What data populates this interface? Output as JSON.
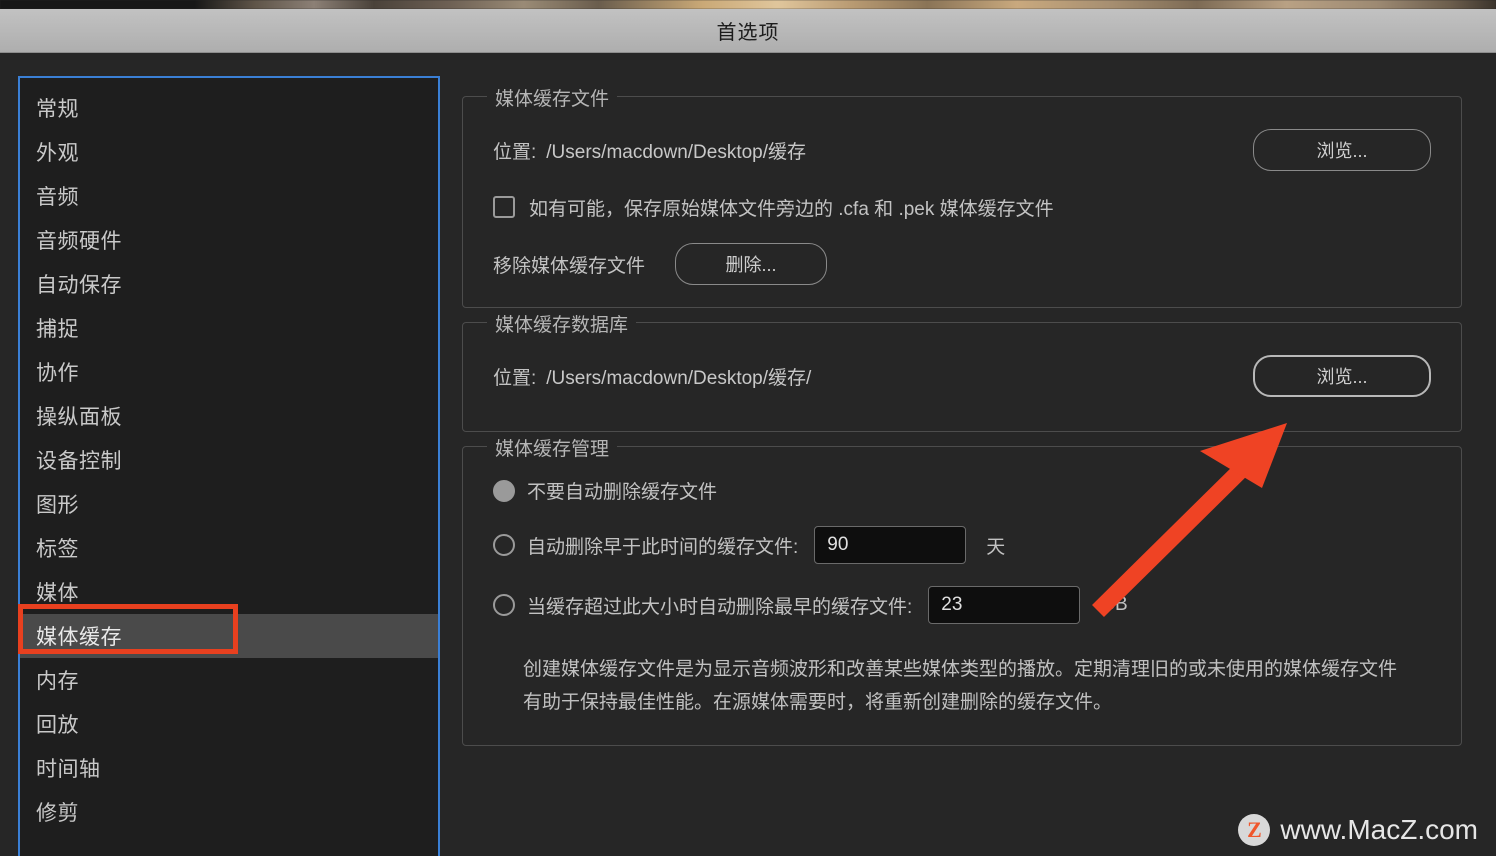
{
  "window": {
    "title": "首选项"
  },
  "sidebar": {
    "items": [
      {
        "label": "常规",
        "selected": false
      },
      {
        "label": "外观",
        "selected": false
      },
      {
        "label": "音频",
        "selected": false
      },
      {
        "label": "音频硬件",
        "selected": false
      },
      {
        "label": "自动保存",
        "selected": false
      },
      {
        "label": "捕捉",
        "selected": false
      },
      {
        "label": "协作",
        "selected": false
      },
      {
        "label": "操纵面板",
        "selected": false
      },
      {
        "label": "设备控制",
        "selected": false
      },
      {
        "label": "图形",
        "selected": false
      },
      {
        "label": "标签",
        "selected": false
      },
      {
        "label": "媒体",
        "selected": false
      },
      {
        "label": "媒体缓存",
        "selected": true
      },
      {
        "label": "内存",
        "selected": false
      },
      {
        "label": "回放",
        "selected": false
      },
      {
        "label": "时间轴",
        "selected": false
      },
      {
        "label": "修剪",
        "selected": false
      }
    ]
  },
  "media_cache_files": {
    "legend": "媒体缓存文件",
    "location_label": "位置:",
    "location_value": "/Users/macdown/Desktop/缓存",
    "browse_label": "浏览...",
    "save_beside_checkbox_label": "如有可能，保存原始媒体文件旁边的 .cfa 和 .pek 媒体缓存文件",
    "remove_label": "移除媒体缓存文件",
    "delete_button_label": "删除..."
  },
  "media_cache_database": {
    "legend": "媒体缓存数据库",
    "location_label": "位置:",
    "location_value": "/Users/macdown/Desktop/缓存/",
    "browse_label": "浏览..."
  },
  "media_cache_management": {
    "legend": "媒体缓存管理",
    "option_never_label": "不要自动删除缓存文件",
    "option_older_than_label": "自动删除早于此时间的缓存文件:",
    "days_value": "90",
    "days_unit": "天",
    "option_exceeds_size_label": "当缓存超过此大小时自动删除最早的缓存文件:",
    "size_value": "23",
    "size_unit": "GB",
    "description": "创建媒体缓存文件是为显示音频波形和改善某些媒体类型的播放。定期清理旧的或未使用的媒体缓存文件有助于保持最佳性能。在源媒体需要时，将重新创建删除的缓存文件。"
  },
  "watermark": {
    "badge": "Z",
    "text": "www.MacZ.com"
  },
  "colors": {
    "accent_focus": "#3a7fd5",
    "annotation_red": "#e8401f",
    "panel_bg": "#262626",
    "sidebar_bg": "#1e1e1e",
    "selected_row": "#4a4a4a"
  }
}
